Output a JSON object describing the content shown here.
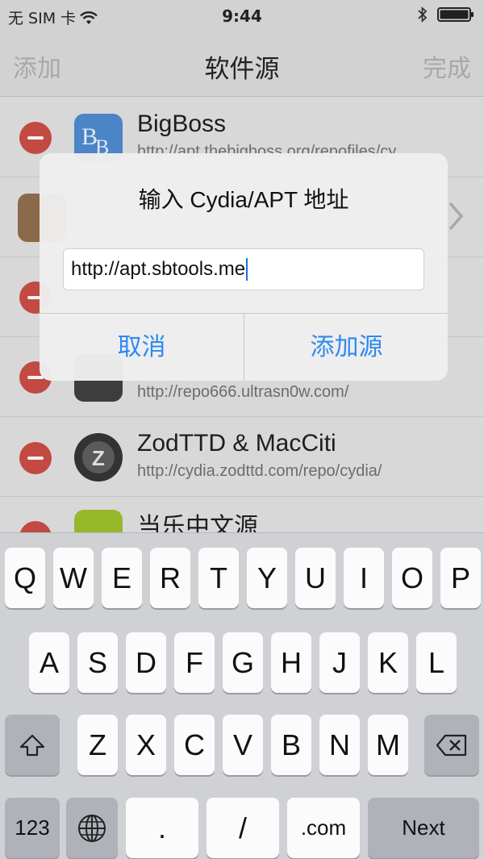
{
  "status_bar": {
    "carrier": "无 SIM 卡",
    "time": "9:44"
  },
  "nav": {
    "left_label": "添加",
    "title": "软件源",
    "right_label": "完成"
  },
  "sources": [
    {
      "name": "BigBoss",
      "url": "http://apt.thebigboss.org/repofiles/cy..."
    },
    {
      "name": "",
      "url": ""
    },
    {
      "name": "",
      "url": ""
    },
    {
      "name": "",
      "url": "http://repo666.ultrasn0w.com/"
    },
    {
      "name": "ZodTTD & MacCiti",
      "url": "http://cydia.zodttd.com/repo/cydia/"
    },
    {
      "name": "当乐中文源",
      "url": ""
    }
  ],
  "alert": {
    "title": "输入 Cydia/APT 地址",
    "input_value": "http://apt.sbtools.me",
    "cancel_label": "取消",
    "confirm_label": "添加源"
  },
  "keyboard": {
    "row1": [
      "Q",
      "W",
      "E",
      "R",
      "T",
      "Y",
      "U",
      "I",
      "O",
      "P"
    ],
    "row2": [
      "A",
      "S",
      "D",
      "F",
      "G",
      "H",
      "J",
      "K",
      "L"
    ],
    "row3": [
      "Z",
      "X",
      "C",
      "V",
      "B",
      "N",
      "M"
    ],
    "numbers_label": "123",
    "dot_label": ".",
    "slash_label": "/",
    "dotcom_label": ".com",
    "next_label": "Next"
  },
  "colors": {
    "accent": "#2d8af0",
    "delete_red": "#c24a43",
    "keyboard_bg": "#cfd1d5"
  }
}
